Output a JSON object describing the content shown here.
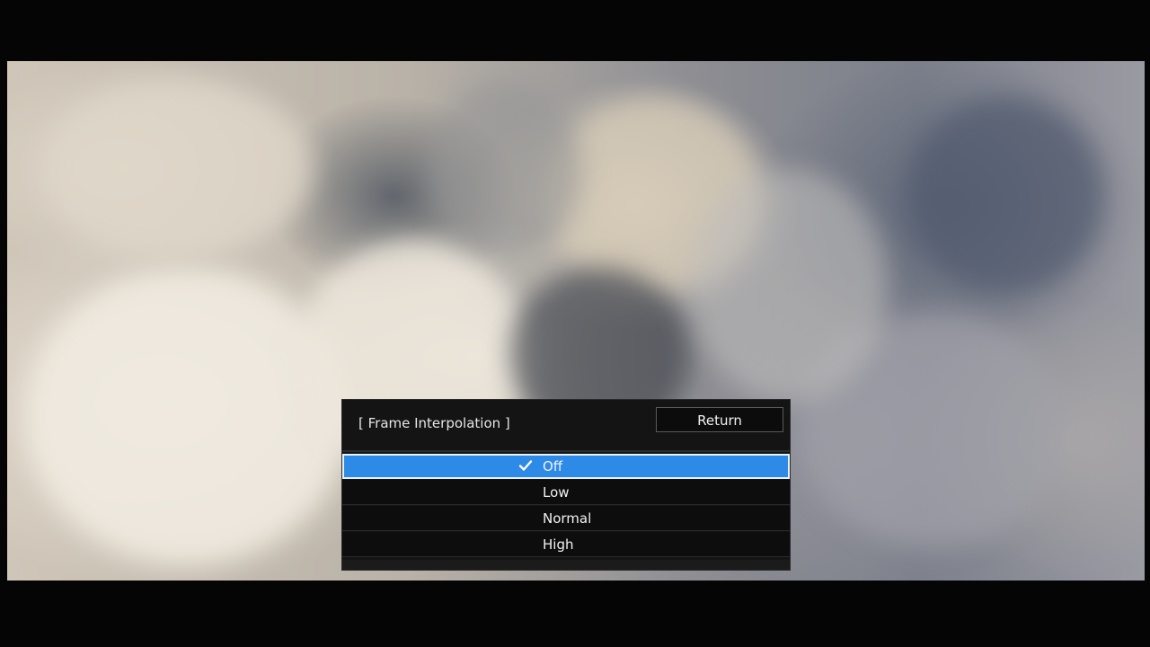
{
  "menu": {
    "title": "[ Frame Interpolation ]",
    "return_label": "Return",
    "options": [
      {
        "label": "Off",
        "selected": true
      },
      {
        "label": "Low",
        "selected": false
      },
      {
        "label": "Normal",
        "selected": false
      },
      {
        "label": "High",
        "selected": false
      }
    ],
    "selected_icon": "checkmark-icon",
    "colors": {
      "selected_background": "#2d8ae6",
      "menu_background": "#141414",
      "text": "#f2f2f2"
    }
  }
}
